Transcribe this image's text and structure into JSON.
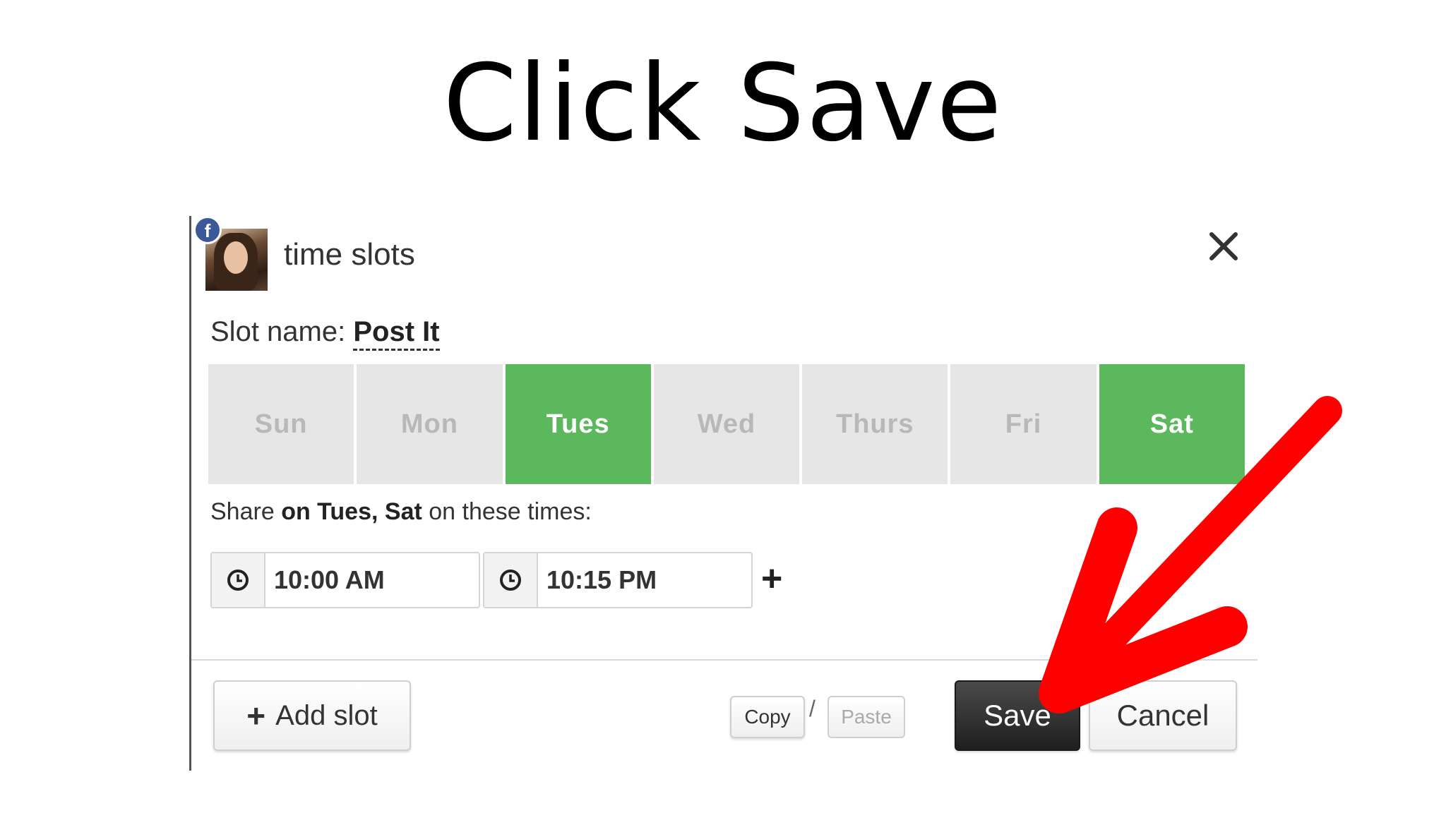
{
  "slide": {
    "title": "Click Save"
  },
  "dialog": {
    "title": "time slots",
    "slot_name_label": "Slot name:",
    "slot_name_value": "Post It",
    "days": [
      {
        "label": "Sun",
        "active": false
      },
      {
        "label": "Mon",
        "active": false
      },
      {
        "label": "Tues",
        "active": true
      },
      {
        "label": "Wed",
        "active": false
      },
      {
        "label": "Thurs",
        "active": false
      },
      {
        "label": "Fri",
        "active": false
      },
      {
        "label": "Sat",
        "active": true
      }
    ],
    "share_prefix": "Share",
    "share_days": "on Tues, Sat",
    "share_suffix": "on these times:",
    "times": [
      "10:00 AM",
      "10:15 PM"
    ],
    "add_time_symbol": "+",
    "add_slot_label": "Add slot",
    "copy_label": "Copy",
    "paste_label": "Paste",
    "separator": "/",
    "save_label": "Save",
    "cancel_label": "Cancel"
  },
  "colors": {
    "active_day": "#5cb85c",
    "inactive_day": "#e6e6e6",
    "annotation_arrow": "#ff0000",
    "save_button": "#2b2b2b"
  },
  "icons": [
    "facebook-icon",
    "close-icon",
    "clock-icon",
    "plus-icon",
    "arrow-annotation"
  ]
}
